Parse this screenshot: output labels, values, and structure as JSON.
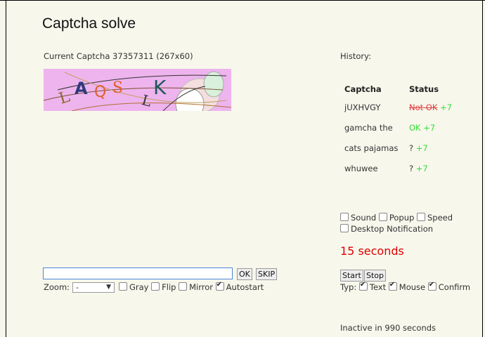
{
  "title": "Captcha solve",
  "current_captcha": "Current Captcha 37357311 (267x60)",
  "captcha_text": "LAQS LK",
  "history": {
    "label": "History:",
    "columns": [
      "Captcha",
      "Status"
    ],
    "rows": [
      {
        "captcha": "jUXHVGY",
        "status": "Not OK",
        "points": "+7",
        "status_type": "notok"
      },
      {
        "captcha": "gamcha the",
        "status": "OK",
        "points": "+7",
        "status_type": "ok"
      },
      {
        "captcha": "cats pajamas",
        "status": "?",
        "points": "+7",
        "status_type": "unknown"
      },
      {
        "captcha": "whuwee",
        "status": "?",
        "points": "+7",
        "status_type": "unknown"
      }
    ]
  },
  "options": {
    "sound": "Sound",
    "popup": "Popup",
    "speed": "Speed",
    "desktop_notification": "Desktop Notification"
  },
  "countdown": "15 seconds",
  "input": {
    "value": "",
    "placeholder": ""
  },
  "buttons": {
    "ok": "OK",
    "skip": "SKIP",
    "start": "Start",
    "stop": "Stop"
  },
  "zoom": {
    "label": "Zoom:",
    "value": "-"
  },
  "view_options": {
    "gray": "Gray",
    "flip": "Flip",
    "mirror": "Mirror",
    "autostart": "Autostart"
  },
  "typ": {
    "label": "Typ:",
    "text": "Text",
    "mouse": "Mouse",
    "confirm": "Confirm"
  },
  "inactive": "Inactive in 990 seconds"
}
